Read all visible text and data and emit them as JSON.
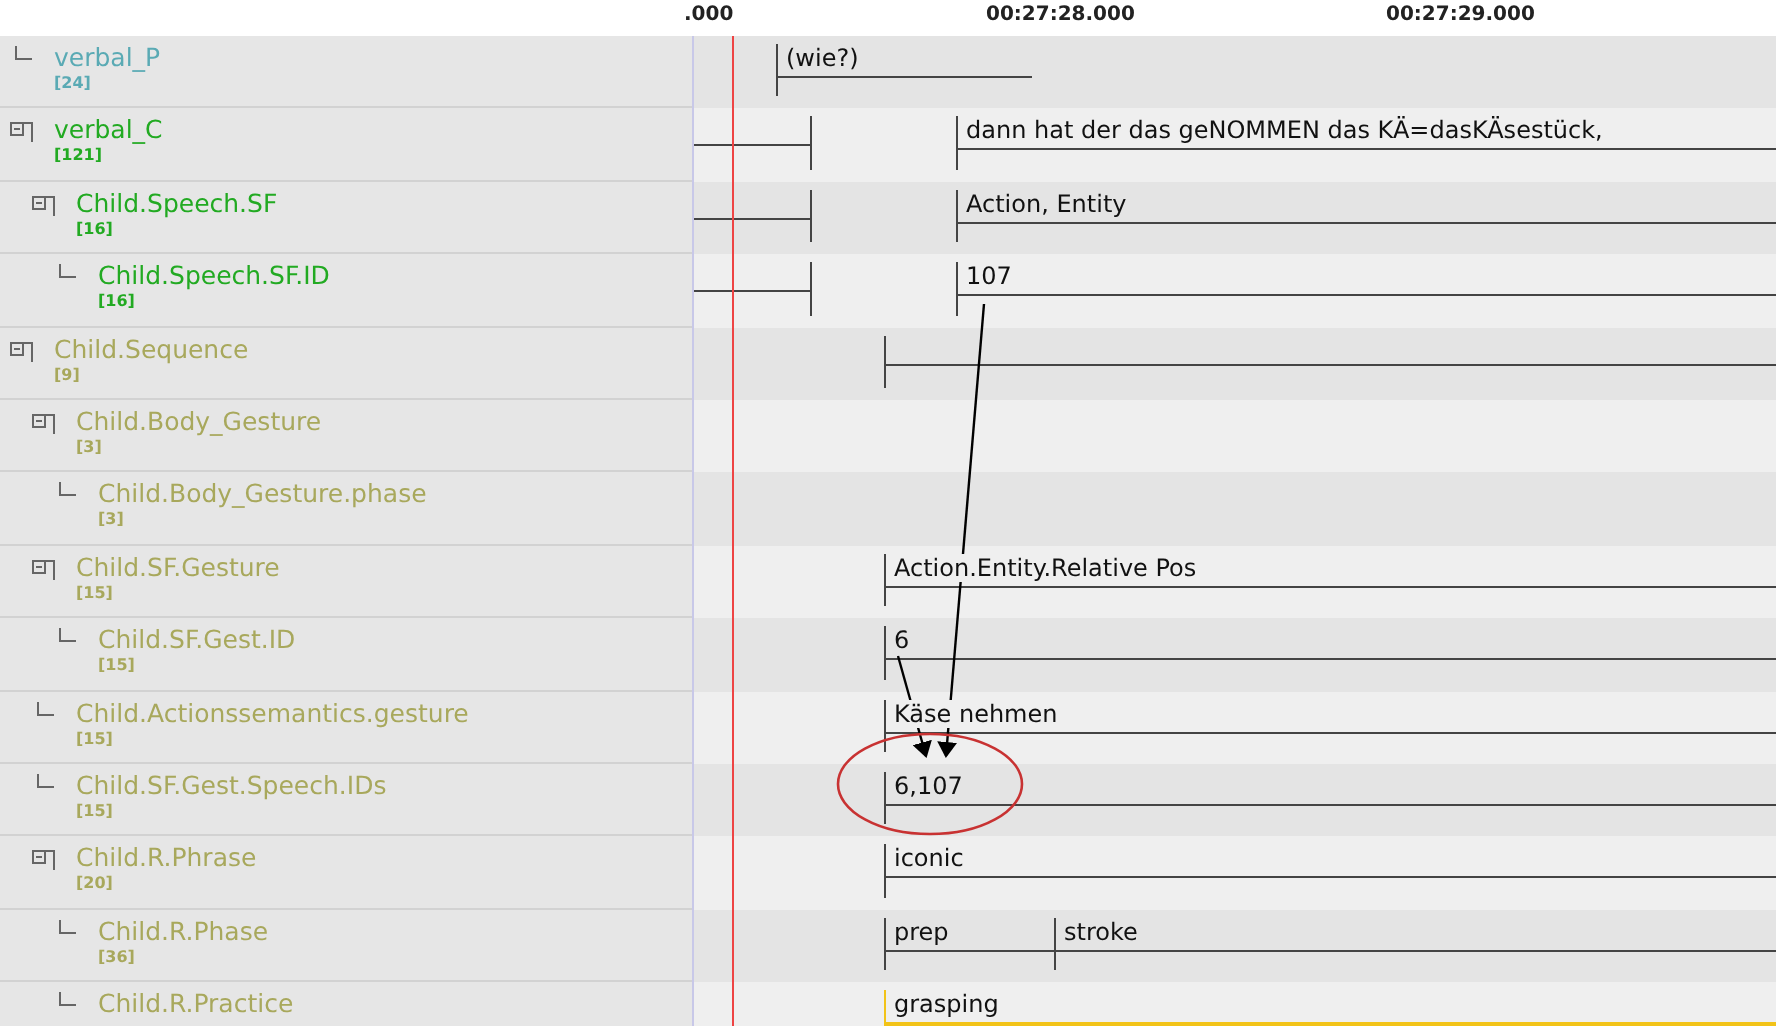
{
  "ruler": {
    "labels": [
      ".000",
      "00:27:28.000",
      "00:27:29.000"
    ]
  },
  "tiers": [
    {
      "name": "verbal_P",
      "count": "[24]",
      "color": "#5aaab4",
      "annotations": [
        {
          "text": "(wie?)",
          "selected": false
        }
      ]
    },
    {
      "name": "verbal_C",
      "count": "[121]",
      "color": "#22aa22",
      "expanded": true,
      "annotations": [
        {
          "text": "dann hat der das geNOMMEN das KÄ=dasKÄsestück,",
          "selected": false
        }
      ],
      "children": [
        {
          "name": "Child.Speech.SF",
          "count": "[16]",
          "color": "#22aa22",
          "expanded": true,
          "annotations": [
            {
              "text": "Action, Entity",
              "selected": false
            }
          ],
          "children": [
            {
              "name": "Child.Speech.SF.ID",
              "count": "[16]",
              "color": "#22aa22",
              "annotations": [
                {
                  "text": "107",
                  "selected": false
                }
              ]
            }
          ]
        }
      ]
    },
    {
      "name": "Child.Sequence",
      "count": "[9]",
      "color": "#a8a85c",
      "expanded": true,
      "children": [
        {
          "name": "Child.Body_Gesture",
          "count": "[3]",
          "color": "#a8a85c",
          "expanded": true,
          "children": [
            {
              "name": "Child.Body_Gesture.phase",
              "count": "[3]",
              "color": "#a8a85c"
            }
          ]
        },
        {
          "name": "Child.SF.Gesture",
          "count": "[15]",
          "color": "#a8a85c",
          "expanded": true,
          "annotations": [
            {
              "text": "Action.Entity.Relative Pos",
              "selected": false
            }
          ],
          "children": [
            {
              "name": "Child.SF.Gest.ID",
              "count": "[15]",
              "color": "#a8a85c",
              "annotations": [
                {
                  "text": "6",
                  "selected": false
                }
              ]
            }
          ]
        },
        {
          "name": "Child.Actionssemantics.gesture",
          "count": "[15]",
          "color": "#a8a85c",
          "annotations": [
            {
              "text": "Käse nehmen",
              "selected": false
            }
          ]
        },
        {
          "name": "Child.SF.Gest.Speech.IDs",
          "count": "[15]",
          "color": "#a8a85c",
          "annotations": [
            {
              "text": "6,107",
              "selected": false
            }
          ]
        },
        {
          "name": "Child.R.Phrase",
          "count": "[20]",
          "color": "#a8a85c",
          "expanded": true,
          "annotations": [
            {
              "text": "iconic",
              "selected": false
            }
          ],
          "children": [
            {
              "name": "Child.R.Phase",
              "count": "[36]",
              "color": "#a8a85c",
              "annotations": [
                {
                  "text": "prep",
                  "selected": false
                },
                {
                  "text": "stroke",
                  "selected": false
                }
              ]
            },
            {
              "name": "Child.R.Practice",
              "color": "#a8a85c",
              "annotations": [
                {
                  "text": "grasping",
                  "selected": true
                }
              ]
            }
          ]
        }
      ]
    }
  ]
}
